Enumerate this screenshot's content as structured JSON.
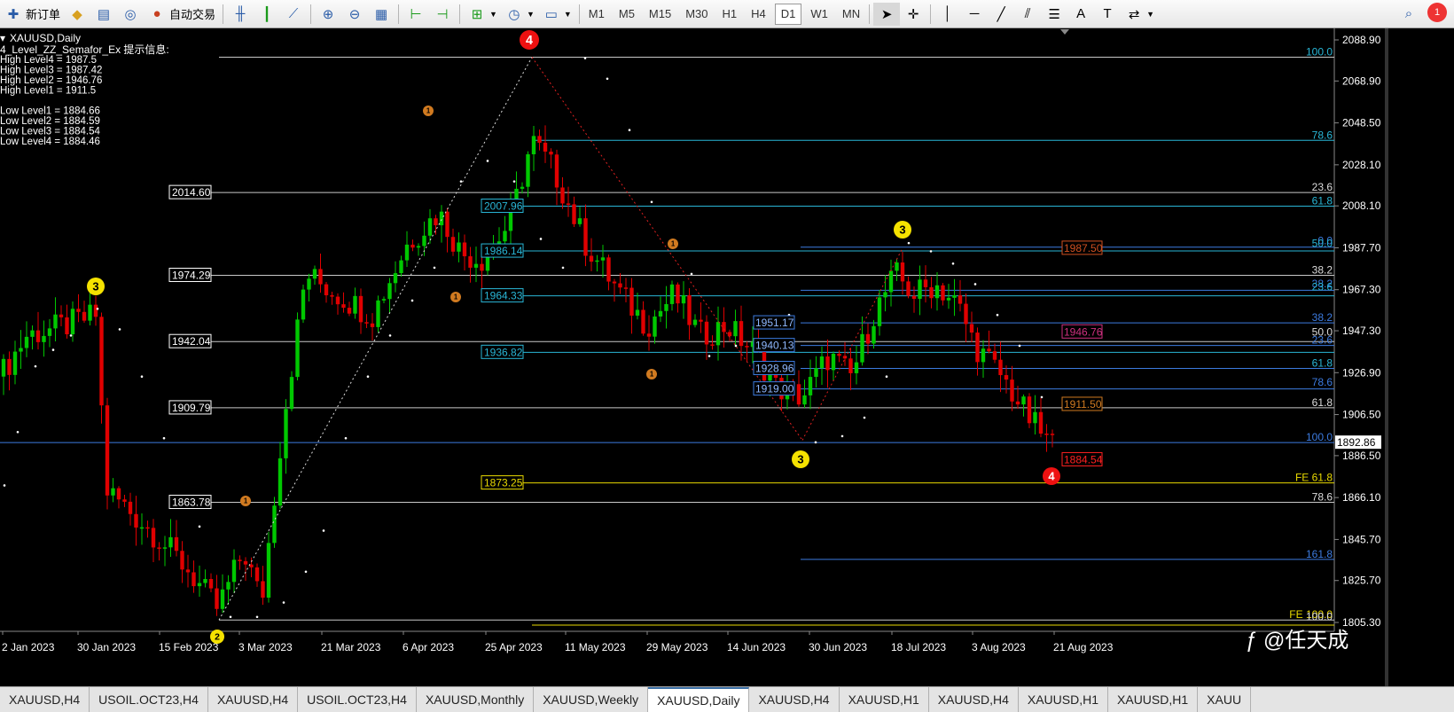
{
  "toolbar": {
    "new_order_label": "新订单",
    "auto_trade_label": "自动交易",
    "timeframes": [
      "M1",
      "M5",
      "M15",
      "M30",
      "H1",
      "H4",
      "D1",
      "W1",
      "MN"
    ],
    "active_timeframe": "D1",
    "notification_count": "1"
  },
  "chart": {
    "symbol_title": "XAUUSD,Daily",
    "indicator_title": "4_Level_ZZ_Semafor_Ex 提示信息:",
    "indicator_lines": [
      "High Level4 = 1987.5",
      "High Level3 = 1987.42",
      "High Level2 = 1946.76",
      "High Level1 = 1911.5",
      "",
      "Low Level1 = 1884.66",
      "Low Level2 = 1884.59",
      "Low Level3 = 1884.54",
      "Low Level4 = 1884.46"
    ],
    "price_axis": [
      "2088.90",
      "2068.90",
      "2048.50",
      "2028.10",
      "2008.10",
      "1987.70",
      "1967.30",
      "1947.30",
      "1926.90",
      "1906.50",
      "1886.50",
      "1866.10",
      "1845.70",
      "1825.70",
      "1805.30"
    ],
    "current_price": "1892.86",
    "date_axis": [
      "2 Jan 2023",
      "30 Jan 2023",
      "15 Feb 2023",
      "3 Mar 2023",
      "21 Mar 2023",
      "6 Apr 2023",
      "25 Apr 2023",
      "11 May 2023",
      "29 May 2023",
      "14 Jun 2023",
      "30 Jun 2023",
      "18 Jul 2023",
      "3 Aug 2023",
      "21 Aug 2023"
    ],
    "left_price_labels": [
      "2014.60",
      "1974.29",
      "1942.04",
      "1909.79",
      "1863.78"
    ],
    "middle_price_labels": [
      "2007.96",
      "1986.14",
      "1964.33",
      "1936.82",
      "1873.25"
    ],
    "small_price_labels": [
      "1951.17",
      "1940.13",
      "1928.96",
      "1919.00"
    ],
    "right_box_labels": [
      "1987.50",
      "1946.76",
      "1911.50",
      "1884.54"
    ],
    "fib_right_labels": [
      "100.0",
      "78.6",
      "23.6",
      "61.8",
      "0.0",
      "50.0",
      "38.2",
      "38.2",
      "23.6",
      "38.2",
      "50.0",
      "23.6",
      "61.8",
      "78.6",
      "61.8",
      "100.0",
      "FE 61.8",
      "78.6",
      "161.8",
      "FE 100.0",
      "100.0"
    ],
    "semafor_markers": [
      "4",
      "3",
      "3",
      "3",
      "4",
      "1",
      "1",
      "1",
      "1",
      "1",
      "2"
    ],
    "watermark": "@任天成",
    "colors": {
      "bull": "#00c800",
      "bear": "#e00000",
      "fib_cyan": "#29b6d6",
      "fib_blue": "#3c7be0",
      "fib_yellow": "#e8d800",
      "fib_white": "#c8c8c8",
      "semafor_red": "#ee1111",
      "semafor_yellow": "#f5e200",
      "semafor_orange": "#d07a20"
    }
  },
  "tabs": [
    "XAUUSD,H4",
    "USOIL.OCT23,H4",
    "XAUUSD,H4",
    "USOIL.OCT23,H4",
    "XAUUSD,Monthly",
    "XAUUSD,Weekly",
    "XAUUSD,Daily",
    "XAUUSD,H4",
    "XAUUSD,H1",
    "XAUUSD,H4",
    "XAUUSD,H1",
    "XAUUSD,H1",
    "XAUU"
  ],
  "active_tab": "XAUUSD,Daily"
}
